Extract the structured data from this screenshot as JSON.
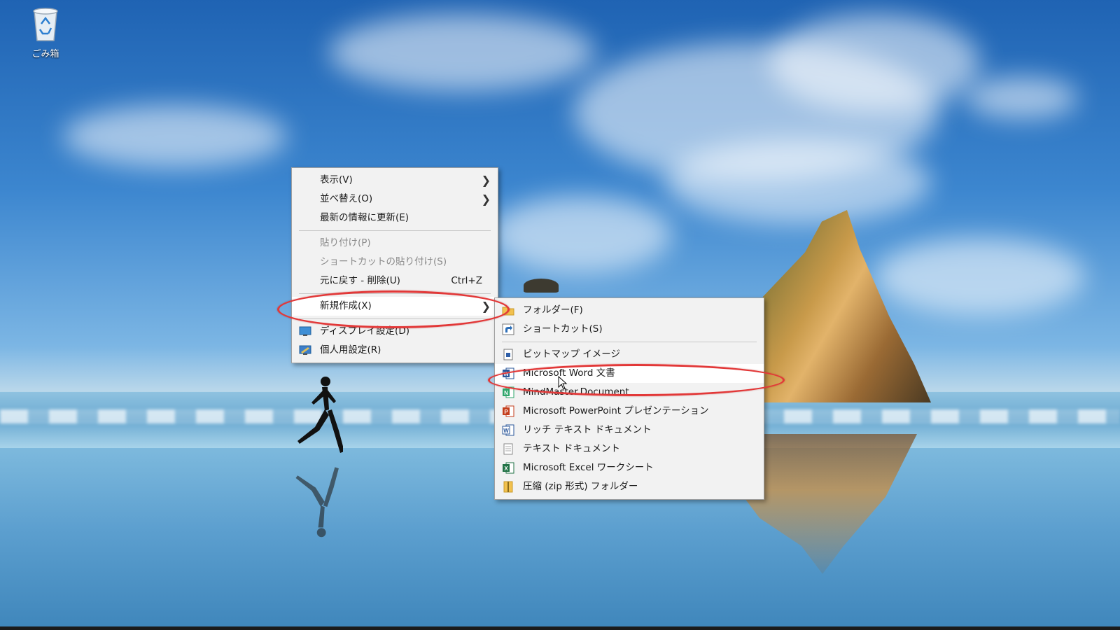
{
  "desktop": {
    "recycle_bin_label": "ごみ箱"
  },
  "context_menu": {
    "items": [
      {
        "label": "表示(V)",
        "submenu": true
      },
      {
        "label": "並べ替え(O)",
        "submenu": true
      },
      {
        "label": "最新の情報に更新(E)"
      },
      {
        "label": "貼り付け(P)",
        "disabled": true
      },
      {
        "label": "ショートカットの貼り付け(S)",
        "disabled": true
      },
      {
        "label": "元に戻す - 削除(U)",
        "shortcut": "Ctrl+Z"
      },
      {
        "label": "新規作成(X)",
        "submenu": true,
        "highlighted": true
      },
      {
        "label": "ディスプレイ設定(D)",
        "icon": "display-settings-icon"
      },
      {
        "label": "個人用設定(R)",
        "icon": "personalize-icon"
      }
    ]
  },
  "new_submenu": {
    "items": [
      {
        "label": "フォルダー(F)",
        "icon": "folder-icon"
      },
      {
        "label": "ショートカット(S)",
        "icon": "shortcut-icon"
      },
      {
        "label": "ビットマップ イメージ",
        "icon": "bitmap-icon"
      },
      {
        "label": "Microsoft Word 文書",
        "icon": "word-icon",
        "highlighted": true
      },
      {
        "label": "MindMaster.Document",
        "icon": "mindmaster-icon"
      },
      {
        "label": "Microsoft PowerPoint プレゼンテーション",
        "icon": "powerpoint-icon"
      },
      {
        "label": "リッチ テキスト ドキュメント",
        "icon": "rtf-icon"
      },
      {
        "label": "テキスト ドキュメント",
        "icon": "text-doc-icon"
      },
      {
        "label": "Microsoft Excel ワークシート",
        "icon": "excel-icon"
      },
      {
        "label": "圧縮 (zip 形式) フォルダー",
        "icon": "zip-folder-icon"
      }
    ]
  },
  "colors": {
    "annotation_ring": "#e23838",
    "menu_bg": "#f2f2f2",
    "disabled_text": "#8a8a8a"
  }
}
